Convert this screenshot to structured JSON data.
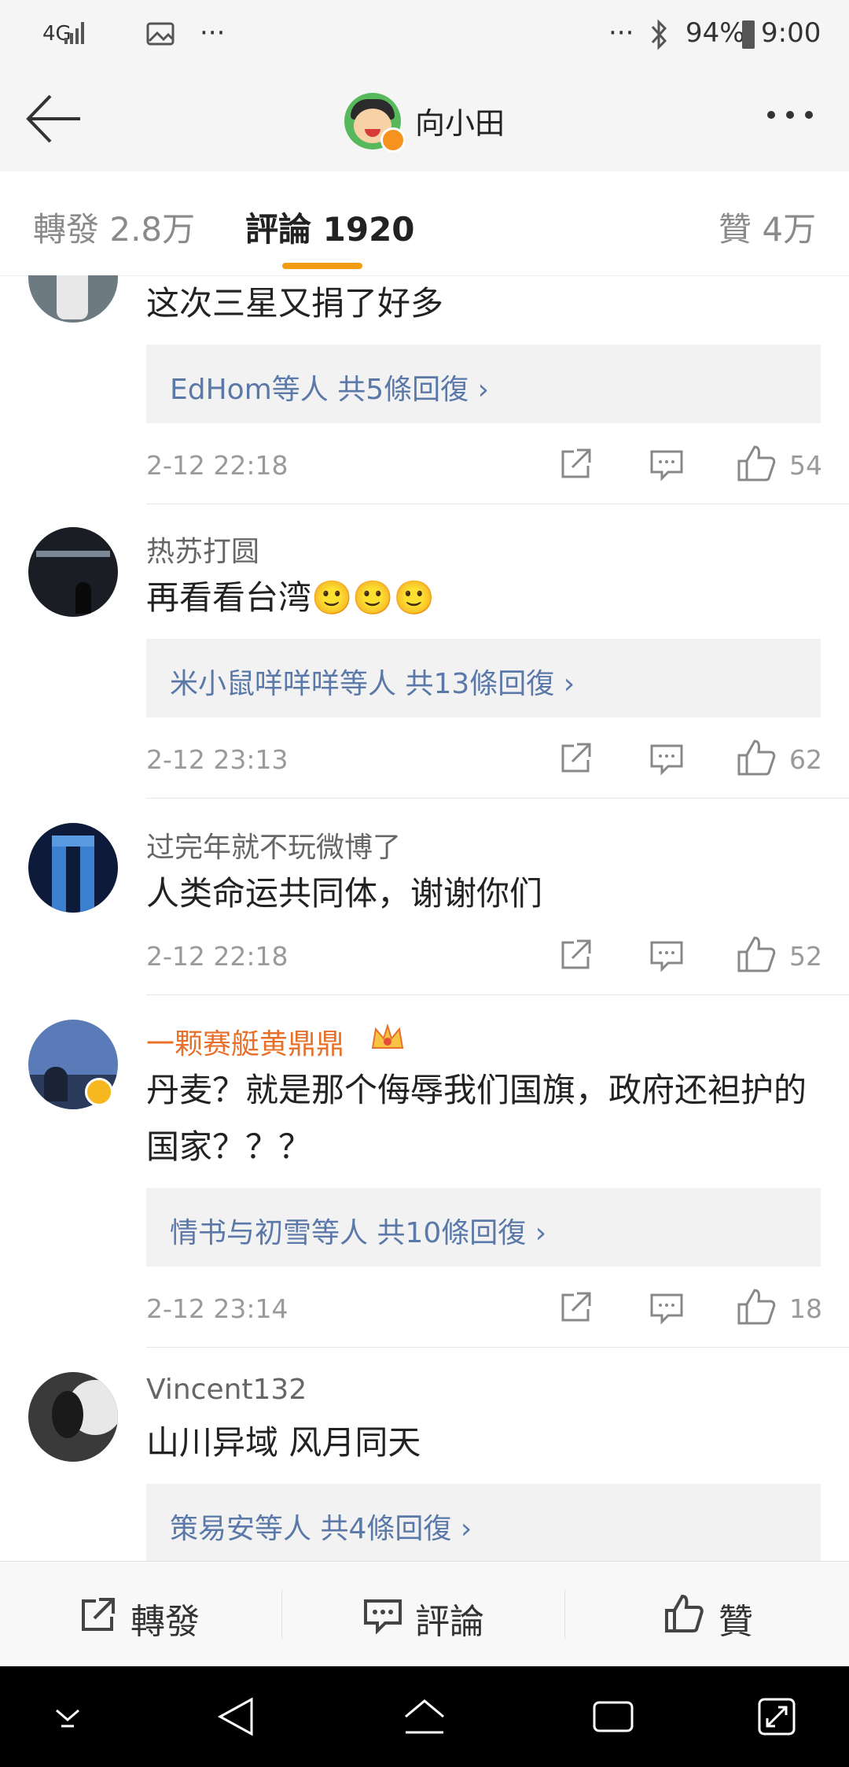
{
  "status_bar": {
    "network": "4G",
    "dots_left": "···",
    "dots_right": "···",
    "battery": "94%",
    "time": "9:00"
  },
  "header": {
    "user_name": "向小田"
  },
  "tabs": {
    "reposts": "轉發 2.8万",
    "comments": "評論 1920",
    "likes": "贊 4万"
  },
  "comments": [
    {
      "name": "",
      "text": "这次三星又捐了好多",
      "reply_who": "EdHom等人",
      "reply_count": "共5條回復 ›",
      "time": "2-12 22:18",
      "likes": "54"
    },
    {
      "name": "热苏打圆",
      "text": "再看看台湾🙂🙂🙂",
      "reply_who": "米小鼠咩咩咩等人",
      "reply_count": "共13條回復 ›",
      "time": "2-12 23:13",
      "likes": "62"
    },
    {
      "name": "过完年就不玩微博了",
      "text": "人类命运共同体，谢谢你们",
      "time": "2-12 22:18",
      "likes": "52"
    },
    {
      "name": "一颗赛艇黄鼎鼎",
      "text": "丹麦？就是那个侮辱我们国旗，政府还袒护的国家？？？",
      "reply_who": "情书与初雪等人",
      "reply_count": "共10條回復 ›",
      "time": "2-12 23:14",
      "likes": "18"
    },
    {
      "name": "Vincent132",
      "text": "山川异域 风月同天",
      "reply_who": "策易安等人",
      "reply_count": "共4條回復 ›"
    }
  ],
  "action_bar": {
    "repost": "轉發",
    "comment": "評論",
    "like": "贊"
  },
  "colors": {
    "accent": "#f39c12",
    "link": "#5a78a8",
    "vip_name": "#e8702a"
  }
}
